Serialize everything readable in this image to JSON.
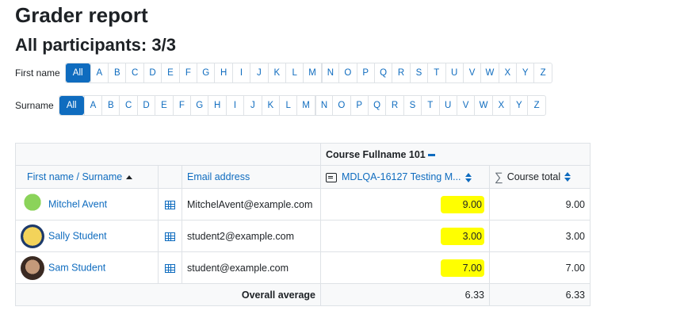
{
  "page": {
    "title": "Grader report",
    "subtitle": "All participants: 3/3"
  },
  "initials_firstname": {
    "label": "First name",
    "letters": [
      "All",
      "A",
      "B",
      "C",
      "D",
      "E",
      "F",
      "G",
      "H",
      "I",
      "J",
      "K",
      "L",
      "M",
      "N",
      "O",
      "P",
      "Q",
      "R",
      "S",
      "T",
      "U",
      "V",
      "W",
      "X",
      "Y",
      "Z"
    ],
    "active": "All"
  },
  "initials_surname": {
    "label": "Surname",
    "letters": [
      "All",
      "A",
      "B",
      "C",
      "D",
      "E",
      "F",
      "G",
      "H",
      "I",
      "J",
      "K",
      "L",
      "M",
      "N",
      "O",
      "P",
      "Q",
      "R",
      "S",
      "T",
      "U",
      "V",
      "W",
      "X",
      "Y",
      "Z"
    ],
    "active": "All"
  },
  "table": {
    "course_name": "Course Fullname 101",
    "headers": {
      "name": "First name / Surname",
      "email": "Email address",
      "activity": "MDLQA-16127 Testing M...",
      "total": "Course total"
    },
    "rows": [
      {
        "name": "Mitchel Avent",
        "email": "MitchelAvent@example.com",
        "grade": "9.00",
        "total": "9.00",
        "avatar_icon": "monster-avatar"
      },
      {
        "name": "Sally Student",
        "email": "student2@example.com",
        "grade": "3.00",
        "total": "3.00",
        "avatar_icon": "smiley-avatar"
      },
      {
        "name": "Sam Student",
        "email": "student@example.com",
        "grade": "7.00",
        "total": "7.00",
        "avatar_icon": "photo-avatar"
      }
    ],
    "average": {
      "label": "Overall average",
      "grade": "6.33",
      "total": "6.33"
    }
  },
  "colors": {
    "link": "#0f6cbf",
    "highlight": "#ffff00",
    "border": "#dee2e6",
    "header_bg": "#f8f9fa"
  }
}
